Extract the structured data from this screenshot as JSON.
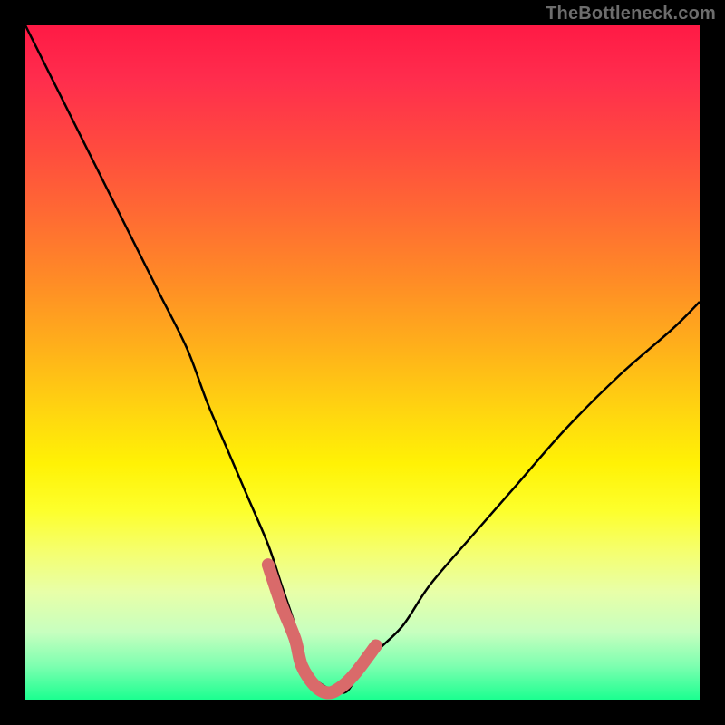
{
  "watermark": "TheBottleneck.com",
  "chart_data": {
    "type": "line",
    "title": "",
    "xlabel": "",
    "ylabel": "",
    "xlim": [
      0,
      100
    ],
    "ylim": [
      0,
      100
    ],
    "grid": false,
    "legend": false,
    "background": "vertical-gradient-red-to-green",
    "series": [
      {
        "name": "bottleneck-curve",
        "color": "#000000",
        "x": [
          0,
          4,
          8,
          12,
          16,
          20,
          24,
          27,
          30,
          33,
          36,
          38,
          40,
          41,
          43,
          47,
          49,
          52,
          56,
          60,
          66,
          73,
          80,
          88,
          96,
          100
        ],
        "y": [
          100,
          92,
          84,
          76,
          68,
          60,
          52,
          44,
          37,
          30,
          23,
          17,
          11,
          7,
          3,
          1,
          3,
          7,
          11,
          17,
          24,
          32,
          40,
          48,
          55,
          59
        ]
      },
      {
        "name": "optimal-range-highlight",
        "color": "#d96a6a",
        "stroke_width_px": 14,
        "linecap": "round",
        "x": [
          36,
          38,
          40,
          41,
          43,
          45,
          47,
          49,
          52
        ],
        "y": [
          20,
          14,
          9,
          5,
          2,
          1,
          2,
          4,
          8
        ]
      }
    ],
    "_note": "Values are read off the plot by eye; axes are unlabeled so x/y are treated as 0–100 percentages of the plot width/height. y=0 at bottom, y=100 at top."
  }
}
